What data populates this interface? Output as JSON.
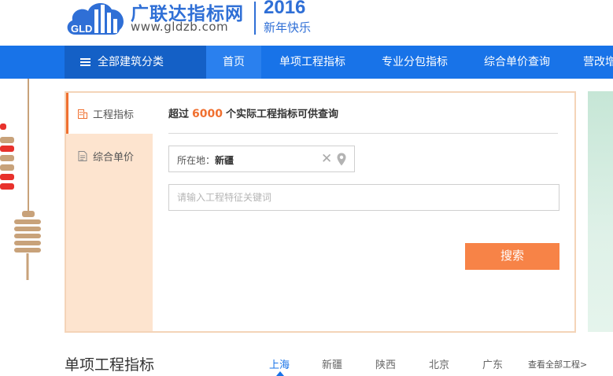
{
  "header": {
    "site_name": "广联达指标网",
    "site_url": "www.gldzb.com",
    "year": "2016",
    "greeting": "新年快乐",
    "logo_letters": "GLD"
  },
  "nav": {
    "category_label": "全部建筑分类",
    "items": [
      {
        "label": "首页",
        "active": true
      },
      {
        "label": "单项工程指标"
      },
      {
        "label": "专业分包指标"
      },
      {
        "label": "综合单价查询"
      },
      {
        "label": "营改增"
      }
    ]
  },
  "search_panel": {
    "tabs": [
      {
        "label": "工程指标",
        "icon": "building-icon",
        "active": true
      },
      {
        "label": "综合单价",
        "icon": "document-icon"
      }
    ],
    "headline_prefix": "超过",
    "headline_count": "6000",
    "headline_suffix": "个实际工程指标可供查询",
    "location_label": "所在地：",
    "location_value": "新疆",
    "keyword_placeholder": "请输入工程特征关键词",
    "search_button": "搜索"
  },
  "section": {
    "title": "单项工程指标",
    "regions": [
      {
        "label": "上海",
        "active": true
      },
      {
        "label": "新疆"
      },
      {
        "label": "陕西"
      },
      {
        "label": "北京"
      },
      {
        "label": "广东"
      }
    ],
    "view_all": "查看全部工程>"
  },
  "colors": {
    "brand_blue": "#1873e8",
    "accent_orange": "#f07030",
    "button_orange": "#f78347",
    "tab_bg": "#fde4cf"
  }
}
